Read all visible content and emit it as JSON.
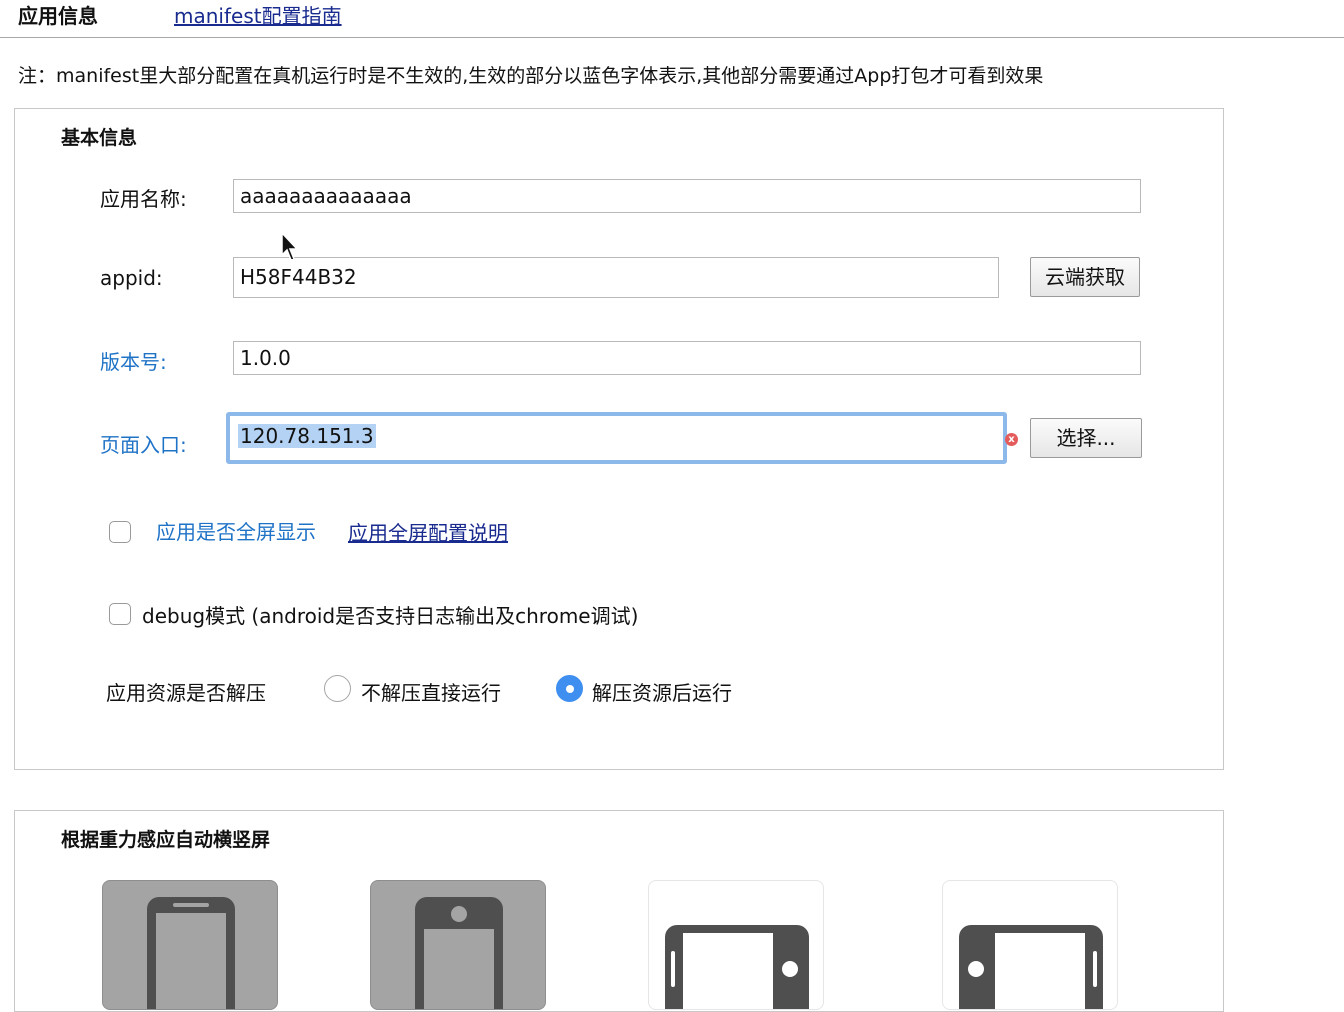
{
  "header": {
    "title": "应用信息",
    "guide_link": "manifest配置指南"
  },
  "note": "注：manifest里大部分配置在真机运行时是不生效的,生效的部分以蓝色字体表示,其他部分需要通过App打包才可看到效果",
  "basic": {
    "section_title": "基本信息",
    "app_name": {
      "label": "应用名称:",
      "value": "aaaaaaaaaaaaaa"
    },
    "appid": {
      "label": "appid:",
      "value": "H58F44B32",
      "button": "云端获取"
    },
    "version": {
      "label": "版本号:",
      "value": "1.0.0"
    },
    "entry": {
      "label": "页面入口:",
      "value": "120.78.151.3",
      "button": "选择..."
    },
    "fullscreen": {
      "label": "应用是否全屏显示",
      "link": "应用全屏配置说明",
      "checked": false
    },
    "debug": {
      "label": "debug模式 (android是否支持日志输出及chrome调试)",
      "checked": false
    },
    "unpack": {
      "label": "应用资源是否解压",
      "options": [
        {
          "label": "不解压直接运行",
          "checked": false
        },
        {
          "label": "解压资源后运行",
          "checked": true
        }
      ]
    }
  },
  "orientation": {
    "section_title": "根据重力感应自动横竖屏",
    "options": [
      {
        "name": "portrait-primary",
        "selected": true
      },
      {
        "name": "portrait-secondary",
        "selected": true
      },
      {
        "name": "landscape-primary",
        "selected": false
      },
      {
        "name": "landscape-secondary",
        "selected": false
      }
    ]
  },
  "colors": {
    "accent_blue": "#1f73c7",
    "link_blue": "#1a2b8f",
    "radio_blue": "#3f8ff0",
    "focus_ring": "#8cb8ea"
  }
}
